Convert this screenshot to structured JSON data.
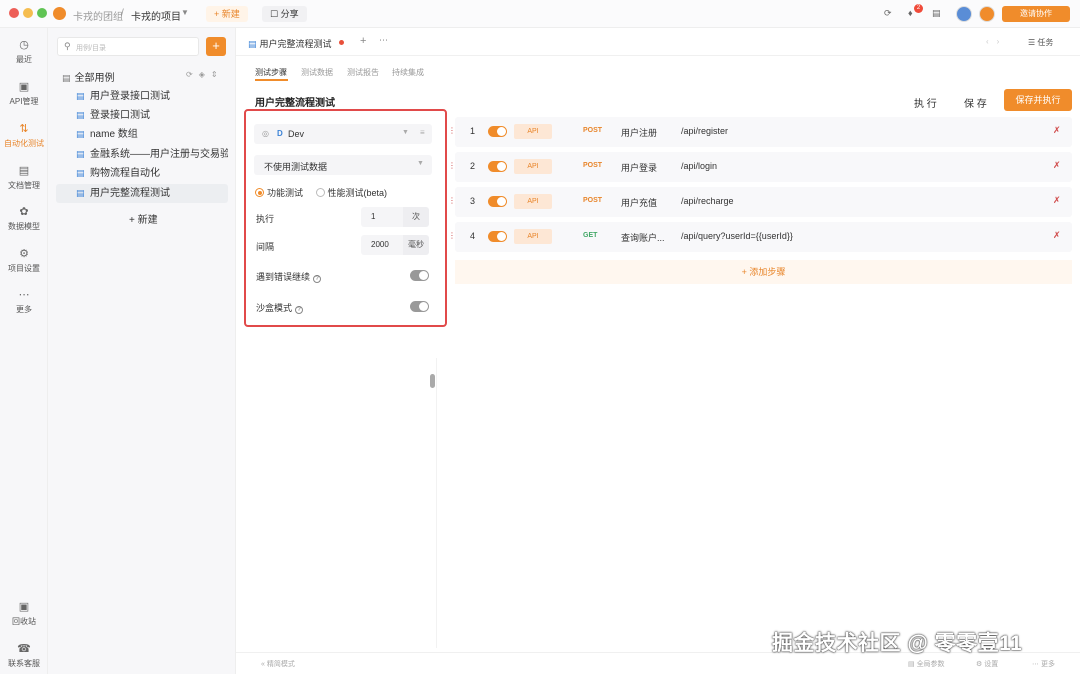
{
  "titlebar": {
    "team": "卡戎的团组",
    "separator": "/",
    "project": "卡戎的项目",
    "new_button": "+ 新建",
    "share_button": "分享",
    "notification_count": "2",
    "invite_button": "邀请协作"
  },
  "nav": {
    "items": [
      {
        "icon": "clock-icon",
        "label": "最近"
      },
      {
        "icon": "api-icon",
        "label": "API管理"
      },
      {
        "icon": "automation-icon",
        "label": "自动化测试"
      },
      {
        "icon": "doc-icon",
        "label": "文档管理"
      },
      {
        "icon": "model-icon",
        "label": "数据模型"
      },
      {
        "icon": "settings-icon",
        "label": "项目设置"
      },
      {
        "icon": "more-icon",
        "label": "更多"
      }
    ],
    "bottom": [
      {
        "icon": "trash-icon",
        "label": "回收站"
      },
      {
        "icon": "headset-icon",
        "label": "联系客服"
      }
    ]
  },
  "tree": {
    "search_placeholder": "用例/目录",
    "root": "全部用例",
    "items": [
      "用户登录接口测试",
      "登录接口测试",
      "name 数组",
      "金融系统——用户注册与交易验...",
      "购物流程自动化",
      "用户完整流程测试"
    ],
    "new_label": "+ 新建"
  },
  "main": {
    "doc_tab": "用户完整流程测试",
    "task_label": "任务",
    "subtabs": [
      "测试步骤",
      "测试数据",
      "测试报告",
      "持续集成"
    ],
    "title": "用户完整流程测试",
    "run": "执 行",
    "save": "保 存",
    "save_run": "保存并执行"
  },
  "settings": {
    "env_badge": "D",
    "env": "Dev",
    "data_option": "不使用测试数据",
    "mode_functional": "功能测试",
    "mode_performance": "性能测试(beta)",
    "runs_label": "执行",
    "runs_value": "1",
    "runs_unit": "次",
    "interval_label": "间隔",
    "interval_value": "2000",
    "interval_unit": "毫秒",
    "continue_on_error": "遇到错误继续",
    "sandbox": "沙盒模式"
  },
  "steps": [
    {
      "no": "1",
      "type": "API",
      "method": "POST",
      "name": "用户注册",
      "path": "/api/register"
    },
    {
      "no": "2",
      "type": "API",
      "method": "POST",
      "name": "用户登录",
      "path": "/api/login"
    },
    {
      "no": "3",
      "type": "API",
      "method": "POST",
      "name": "用户充值",
      "path": "/api/recharge"
    },
    {
      "no": "4",
      "type": "API",
      "method": "GET",
      "name": "查询账户...",
      "path": "/api/query?userId={{userId}}"
    }
  ],
  "add_step": "+ 添加步骤",
  "footer": {
    "left": "« 精简模式",
    "global_params": "全局参数",
    "settings": "设置",
    "more": "更多"
  },
  "watermark": "掘金技术社区 @ 零零壹11"
}
